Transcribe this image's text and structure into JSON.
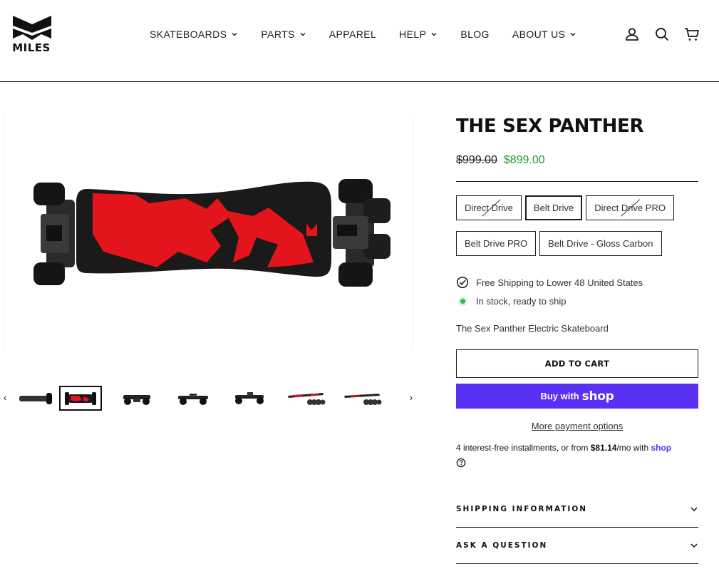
{
  "brand": {
    "logo_text": "MILES"
  },
  "nav": {
    "items": [
      {
        "label": "SKATEBOARDS",
        "dropdown": true
      },
      {
        "label": "PARTS",
        "dropdown": true
      },
      {
        "label": "APPAREL",
        "dropdown": false
      },
      {
        "label": "HELP",
        "dropdown": true
      },
      {
        "label": "BLOG",
        "dropdown": false
      },
      {
        "label": "ABOUT US",
        "dropdown": true
      }
    ]
  },
  "header_icons": [
    "account-icon",
    "search-icon",
    "cart-icon"
  ],
  "gallery": {
    "thumbnail_count": 8,
    "active_thumbnail": 2
  },
  "product": {
    "title": "THE SEX PANTHER",
    "price_old": "$999.00",
    "price_new": "$899.00",
    "variants": [
      {
        "label": "Direct Drive",
        "sold_out": true,
        "selected": false
      },
      {
        "label": "Belt Drive",
        "sold_out": false,
        "selected": true
      },
      {
        "label": "Direct Drive PRO",
        "sold_out": true,
        "selected": false
      },
      {
        "label": "Belt Drive PRO",
        "sold_out": false,
        "selected": false
      },
      {
        "label": "Belt Drive - Gloss Carbon",
        "sold_out": false,
        "selected": false
      }
    ],
    "shipping_note": "Free Shipping to Lower 48 United States",
    "stock_note": "In stock, ready to ship",
    "description": "The Sex Panther Electric Skateboard"
  },
  "buttons": {
    "add_to_cart": "ADD TO CART",
    "buy_with": "Buy with",
    "buy_shop": "shop",
    "more_payment": "More payment options"
  },
  "installments": {
    "prefix": "4 interest-free installments, or from ",
    "amount": "$81.14",
    "suffix": "/mo with ",
    "provider": "shop"
  },
  "accordions": [
    {
      "label": "SHIPPING INFORMATION"
    },
    {
      "label": "ASK A QUESTION"
    }
  ],
  "colors": {
    "accent_purple": "#5a31f4",
    "sale_green": "#1d9b2c",
    "deck_red": "#e3141c",
    "text": "#1c1c1c"
  }
}
